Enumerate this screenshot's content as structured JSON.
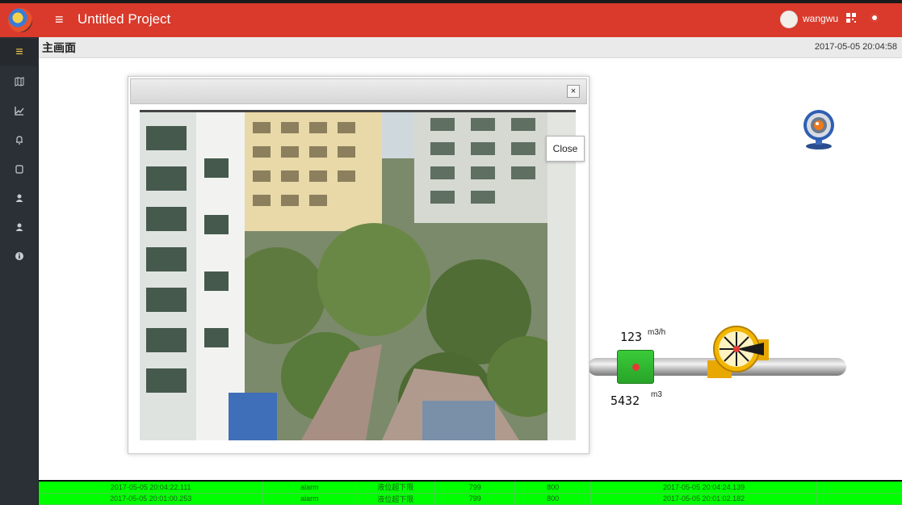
{
  "header": {
    "app_title": "Untitled Project",
    "menu_icon": "hamburger-icon",
    "user_name": "wangwu"
  },
  "sidebar": {
    "items": [
      {
        "icon": "menu-icon",
        "glyph": "≡"
      },
      {
        "icon": "map-icon",
        "glyph": "⊞"
      },
      {
        "icon": "chart-icon",
        "glyph": "↗"
      },
      {
        "icon": "bell-icon",
        "glyph": "♪"
      },
      {
        "icon": "copy-icon",
        "glyph": "▢"
      },
      {
        "icon": "user-icon",
        "glyph": "▲"
      },
      {
        "icon": "user-icon",
        "glyph": "▲"
      },
      {
        "icon": "info-icon",
        "glyph": "●"
      }
    ]
  },
  "page": {
    "title": "主画面",
    "datetime": "2017-05-05 20:04:58"
  },
  "modal": {
    "close_symbol": "×",
    "close_tooltip": "Close"
  },
  "process": {
    "flow_rate": "123",
    "flow_unit": "m3/h",
    "total_volume": "5432",
    "total_unit": "m3"
  },
  "alarms": {
    "rows": [
      [
        "2017-05-05 20:04:22.111",
        "alarm",
        "液位超下限",
        "799",
        "800",
        "2017-05-05 20:04:24.139",
        ""
      ],
      [
        "2017-05-05 20:01:00.253",
        "alarm",
        "液位超下限",
        "799",
        "800",
        "2017-05-05 20:01:02.182",
        ""
      ]
    ]
  },
  "colors": {
    "topbar": "#d93a2b",
    "sidebar": "#2b3036",
    "alarm_row": "#00ff00",
    "valve": "#28a428",
    "pump": "#f0b400"
  }
}
